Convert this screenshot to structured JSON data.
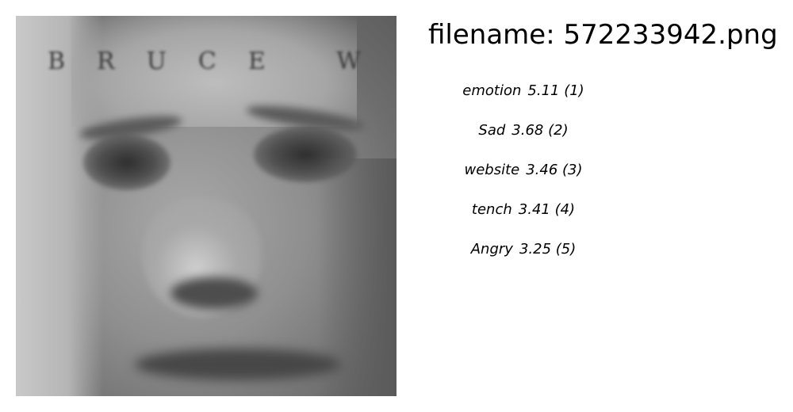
{
  "image": {
    "overlay_text": "BRUCE W"
  },
  "filename": "filename: 572233942.png",
  "predictions": [
    {
      "label": "emotion",
      "score": "5.11",
      "rank": "(1)"
    },
    {
      "label": "Sad",
      "score": "3.68",
      "rank": "(2)"
    },
    {
      "label": "website",
      "score": "3.46",
      "rank": "(3)"
    },
    {
      "label": "tench",
      "score": "3.41",
      "rank": "(4)"
    },
    {
      "label": "Angry",
      "score": "3.25",
      "rank": "(5)"
    }
  ]
}
